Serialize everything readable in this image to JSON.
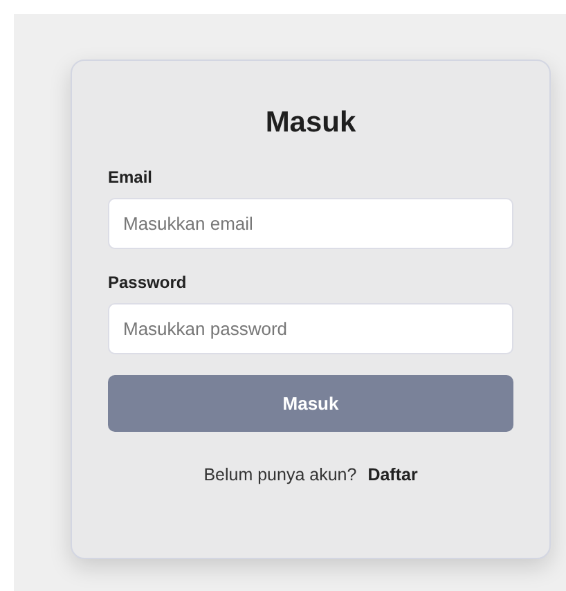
{
  "title": "Masuk",
  "fields": [
    {
      "label": "Email",
      "placeholder": "Masukkan email"
    },
    {
      "label": "Password",
      "placeholder": "Masukkan password"
    }
  ],
  "submit_button": "Masuk",
  "footer": {
    "text": "Belum punya akun?",
    "link": "Daftar"
  }
}
